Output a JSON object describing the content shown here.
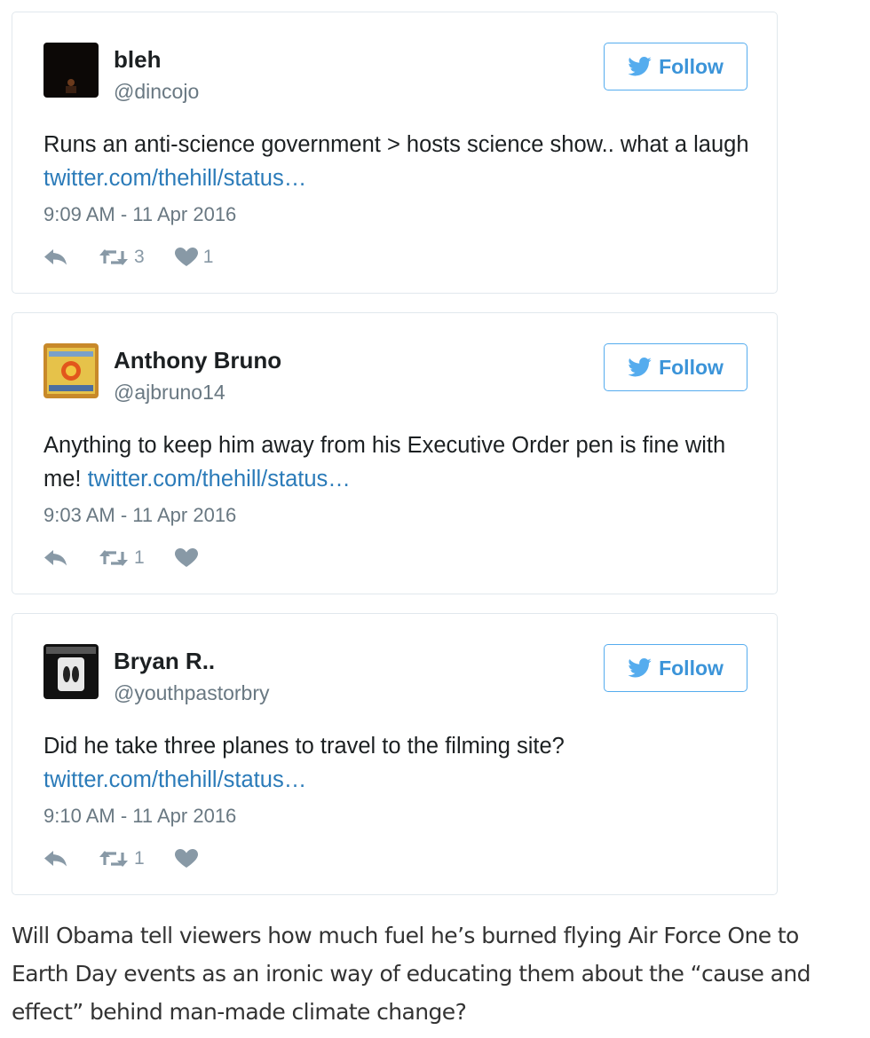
{
  "follow_label": "Follow",
  "tweets": [
    {
      "name": "bleh",
      "handle": "@dincojo",
      "text": "Runs an anti-science government > hosts science show.. what a laugh",
      "link": "twitter.com/thehill/status…",
      "time": "9:09 AM - 11 Apr 2016",
      "retweets": "3",
      "likes": "1"
    },
    {
      "name": "Anthony Bruno",
      "handle": "@ajbruno14",
      "text": "Anything to keep him away from his Executive Order pen is fine with me!",
      "link": "twitter.com/thehill/status…",
      "time": "9:03 AM - 11 Apr 2016",
      "retweets": "1",
      "likes": ""
    },
    {
      "name": "Bryan R..",
      "handle": "@youthpastorbry",
      "text": "Did he take three planes to travel to the filming site?",
      "link": "twitter.com/thehill/status…",
      "time": "9:10 AM - 11 Apr 2016",
      "retweets": "1",
      "likes": ""
    }
  ],
  "article_text": "Will Obama tell viewers how much fuel he’s burned flying Air Force One to Earth Day events as an ironic way of educating them about the “cause and effect” behind man-made climate change?",
  "colors": {
    "link": "#2b7bb9",
    "follow_border": "#55acee",
    "follow_text": "#3b94d9",
    "muted": "#697882",
    "icon": "#8899a6"
  }
}
